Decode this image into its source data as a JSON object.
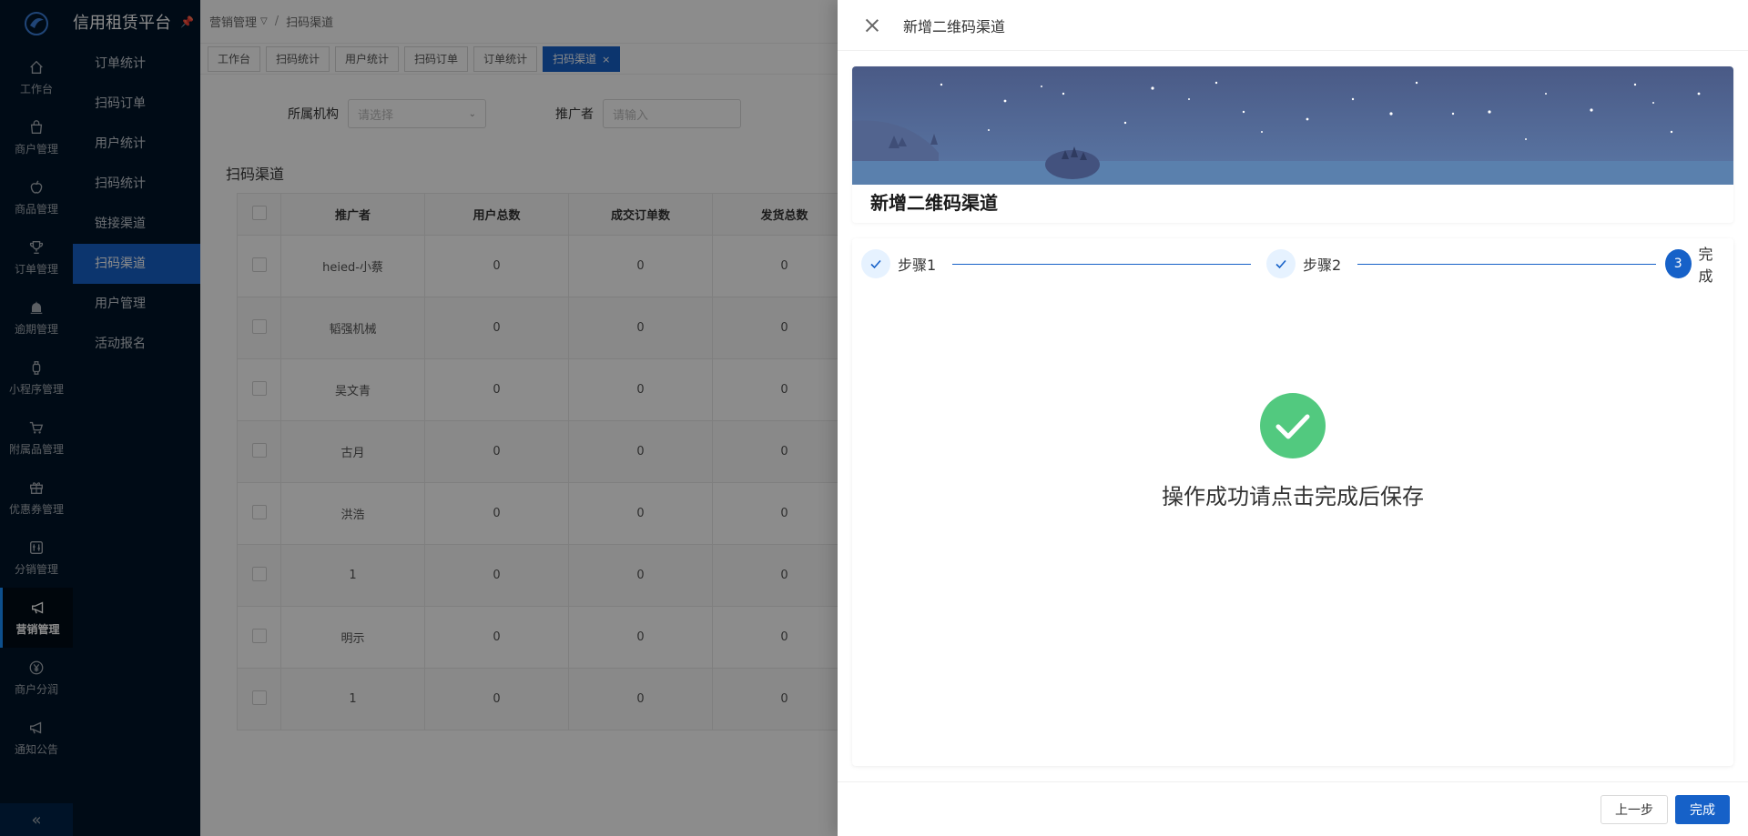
{
  "app": {
    "title": "信用租赁平台"
  },
  "rail": {
    "items": [
      {
        "label": "工作台",
        "icon": "home-icon"
      },
      {
        "label": "商户管理",
        "icon": "bag-icon"
      },
      {
        "label": "商品管理",
        "icon": "apple-icon"
      },
      {
        "label": "订单管理",
        "icon": "trophy-icon"
      },
      {
        "label": "逾期管理",
        "icon": "alarm-icon"
      },
      {
        "label": "小程序管理",
        "icon": "watch-icon"
      },
      {
        "label": "附属品管理",
        "icon": "cart-icon"
      },
      {
        "label": "优惠券管理",
        "icon": "gift-icon"
      },
      {
        "label": "分销管理",
        "icon": "sliders-icon"
      },
      {
        "label": "营销管理",
        "icon": "megaphone-icon",
        "active": true
      },
      {
        "label": "商户分润",
        "icon": "yen-icon"
      },
      {
        "label": "通知公告",
        "icon": "megaphone-icon"
      }
    ],
    "collapse": "«"
  },
  "submenu": {
    "items": [
      {
        "label": "订单统计"
      },
      {
        "label": "扫码订单"
      },
      {
        "label": "用户统计"
      },
      {
        "label": "扫码统计"
      },
      {
        "label": "链接渠道"
      },
      {
        "label": "扫码渠道",
        "active": true
      },
      {
        "label": "用户管理"
      },
      {
        "label": "活动报名"
      }
    ]
  },
  "breadcrumb": {
    "parent": "营销管理",
    "separator": "/",
    "current": "扫码渠道"
  },
  "tabs": [
    {
      "label": "工作台"
    },
    {
      "label": "扫码统计"
    },
    {
      "label": "用户统计"
    },
    {
      "label": "扫码订单"
    },
    {
      "label": "订单统计"
    },
    {
      "label": "扫码渠道",
      "active": true,
      "close": "×"
    }
  ],
  "filters": {
    "org_label": "所属机构",
    "org_placeholder": "请选择",
    "promoter_label": "推广者",
    "promoter_placeholder": "请输入"
  },
  "table": {
    "title": "扫码渠道",
    "headers": [
      "推广者",
      "用户总数",
      "成交订单数",
      "发货总数"
    ],
    "rows": [
      [
        "heied-小蔡",
        "0",
        "0",
        "0"
      ],
      [
        "韬强机械",
        "0",
        "0",
        "0"
      ],
      [
        "吴文青",
        "0",
        "0",
        "0"
      ],
      [
        "古月",
        "0",
        "0",
        "0"
      ],
      [
        "洪浩",
        "0",
        "0",
        "0"
      ],
      [
        "1",
        "0",
        "0",
        "0"
      ],
      [
        "明示",
        "0",
        "0",
        "0"
      ],
      [
        "1",
        "0",
        "0",
        "0"
      ]
    ]
  },
  "drawer": {
    "title": "新增二维码渠道",
    "banner_title": "新增二维码渠道",
    "steps": [
      {
        "label": "步骤1",
        "status": "done"
      },
      {
        "label": "步骤2",
        "status": "done"
      },
      {
        "label": "完成",
        "status": "current",
        "num": "3"
      }
    ],
    "success_text": "操作成功请点击完成后保存",
    "prev_button": "上一步",
    "finish_button": "完成"
  },
  "colors": {
    "primary": "#1661c8",
    "sidebar": "#001529",
    "success": "#52c97f"
  }
}
